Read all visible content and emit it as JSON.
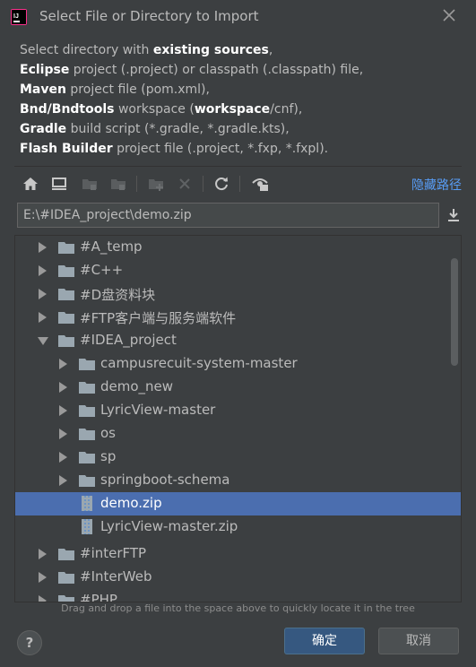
{
  "window": {
    "title": "Select File or Directory to Import"
  },
  "description": {
    "line1_a": "Select directory with ",
    "line1_b": "existing sources",
    "line1_c": ",",
    "line2_a": "Eclipse",
    "line2_b": " project (.project) or classpath (.classpath) file,",
    "line3_a": "Maven",
    "line3_b": " project file (pom.xml),",
    "line4_a": "Bnd/Bndtools",
    "line4_b": " workspace (",
    "line4_c": "workspace",
    "line4_d": "/cnf),",
    "line5_a": "Gradle",
    "line5_b": " build script (*.gradle, *.gradle.kts),",
    "line6_a": "Flash Builder",
    "line6_b": " project file (.project, *.fxp, *.fxpl)."
  },
  "toolbar": {
    "icons": [
      "home-icon",
      "desktop-icon",
      "project-folder-icon",
      "module-folder-icon",
      "new-folder-icon",
      "delete-icon",
      "refresh-icon",
      "show-hidden-icon"
    ],
    "hide_path_label": "隐藏路径"
  },
  "path": {
    "value": "E:\\#IDEA_project\\demo.zip"
  },
  "tree": {
    "items": [
      {
        "label": "#A_temp",
        "type": "folder",
        "expanded": false
      },
      {
        "label": "#C++",
        "type": "folder",
        "expanded": false
      },
      {
        "label": "#D盘资料块",
        "type": "folder",
        "expanded": false
      },
      {
        "label": "#FTP客户端与服务端软件",
        "type": "folder",
        "expanded": false
      },
      {
        "label": "#IDEA_project",
        "type": "folder",
        "expanded": true
      },
      {
        "label": "campusrecuit-system-master",
        "type": "folder",
        "expanded": false
      },
      {
        "label": "demo_new",
        "type": "folder",
        "expanded": false
      },
      {
        "label": "LyricView-master",
        "type": "folder",
        "expanded": false
      },
      {
        "label": "os",
        "type": "folder",
        "expanded": false
      },
      {
        "label": "sp",
        "type": "folder",
        "expanded": false
      },
      {
        "label": "springboot-schema",
        "type": "folder",
        "expanded": false
      },
      {
        "label": "demo.zip",
        "type": "zip",
        "selected": true
      },
      {
        "label": "LyricView-master.zip",
        "type": "zip"
      },
      {
        "label": "#interFTP",
        "type": "folder",
        "expanded": false
      },
      {
        "label": "#InterWeb",
        "type": "folder",
        "expanded": false
      },
      {
        "label": "#PHP",
        "type": "folder",
        "expanded": false
      }
    ]
  },
  "hint": "Drag and drop a file into the space above to quickly locate it in the tree",
  "buttons": {
    "help": "?",
    "ok": "确定",
    "cancel": "取消"
  },
  "colors": {
    "background": "#3c3f41",
    "selection": "#4b6eaf",
    "link": "#589df6",
    "primary_button": "#365880"
  }
}
